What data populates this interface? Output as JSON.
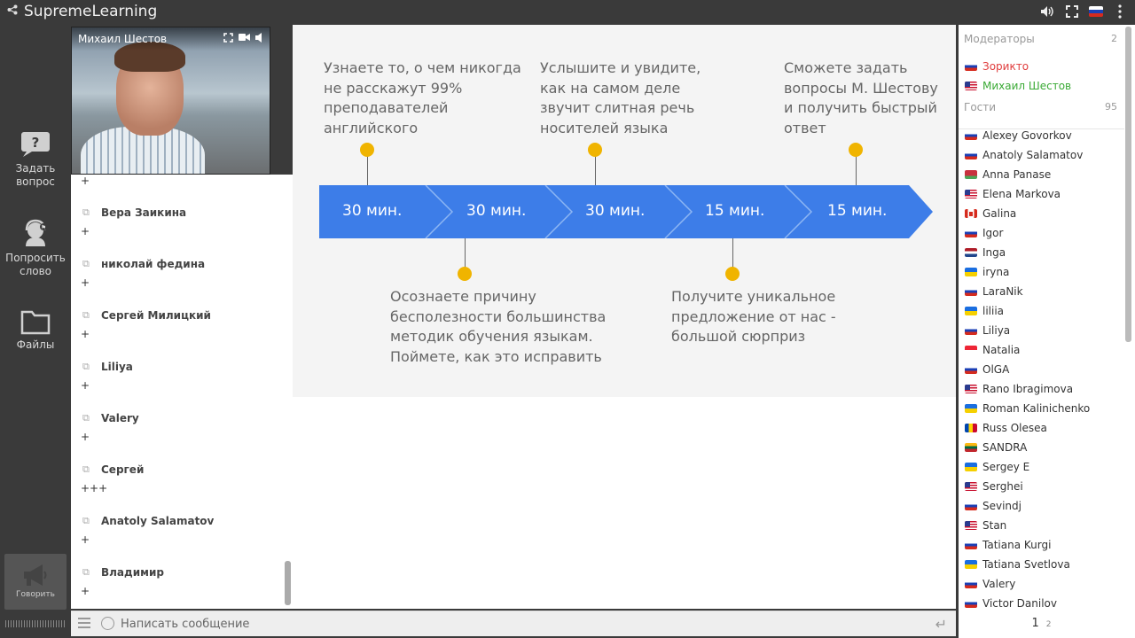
{
  "app": {
    "title": "SupremeLearning"
  },
  "topbar": {
    "icons": [
      "share-icon",
      "volume-icon",
      "fullscreen-icon",
      "language-ru-flag"
    ]
  },
  "leftbar": {
    "ask_label": "Задать вопрос",
    "ask_line1": "Задать",
    "ask_line2": "вопрос",
    "word_line1": "Попросить",
    "word_line2": "слово",
    "files_label": "Файлы",
    "speak_label": "Говорить"
  },
  "video": {
    "presenter": "Михаил Шестов"
  },
  "chat": {
    "messages": [
      {
        "name": "",
        "text": "+"
      },
      {
        "name": "Вера Заикина",
        "text": "+"
      },
      {
        "name": "николай федина",
        "text": "+"
      },
      {
        "name": "Сергей Милицкий",
        "text": "+"
      },
      {
        "name": "Liliya",
        "text": "+"
      },
      {
        "name": "Valery",
        "text": "+"
      },
      {
        "name": "Сергей",
        "text": "+++"
      },
      {
        "name": "Anatoly Salamatov",
        "text": "+"
      },
      {
        "name": "Владимир",
        "text": "+"
      }
    ],
    "composer_placeholder": "Написать сообщение"
  },
  "slide": {
    "top_texts": [
      [
        "Узнаете то, о чем никогда",
        "не расскажут 99%",
        "преподавателей",
        "английского"
      ],
      [
        "Услышите и увидите,",
        "как на самом деле",
        "звучит слитная речь",
        "носителей языка"
      ],
      [
        "Сможете задать",
        "вопросы М. Шестову",
        "и получить быстрый",
        "ответ"
      ]
    ],
    "bottom_texts": [
      [
        "Осознаете причину",
        "бесполезности большинства",
        "методик обучения языкам.",
        "Поймете, как это исправить"
      ],
      [
        "Получите уникальное",
        "предложение от нас -",
        "большой сюрприз"
      ]
    ],
    "segments": [
      "30 мин.",
      "30 мин.",
      "30 мин.",
      "15 мин.",
      "15 мин."
    ],
    "colors": {
      "arrow": "#3d7de8",
      "dot": "#f0b400"
    }
  },
  "sidebar": {
    "moderators_label": "Модераторы",
    "moderators_count": "2",
    "moderators": [
      {
        "name": "Зорикто",
        "flag": "ru"
      },
      {
        "name": "Михаил Шестов",
        "flag": "us"
      }
    ],
    "guests_label": "Гости",
    "guests_count": "95",
    "guests": [
      {
        "name": "Alexey Govorkov",
        "flag": "ru"
      },
      {
        "name": "Anatoly Salamatov",
        "flag": "ru"
      },
      {
        "name": "Anna Panase",
        "flag": "by"
      },
      {
        "name": "Elena Markova",
        "flag": "us"
      },
      {
        "name": "Galina",
        "flag": "ca"
      },
      {
        "name": "Igor",
        "flag": "ru"
      },
      {
        "name": "Inga",
        "flag": "nl"
      },
      {
        "name": "iryna",
        "flag": "ua"
      },
      {
        "name": "LaraNik",
        "flag": "ru"
      },
      {
        "name": "liliia",
        "flag": "ua"
      },
      {
        "name": "Liliya",
        "flag": "ru"
      },
      {
        "name": "Natalia",
        "flag": "sg"
      },
      {
        "name": "OlGA",
        "flag": "ru"
      },
      {
        "name": "Rano Ibragimova",
        "flag": "us"
      },
      {
        "name": "Roman Kalinichenko",
        "flag": "ua"
      },
      {
        "name": "Russ Olesea",
        "flag": "md"
      },
      {
        "name": "SANDRA",
        "flag": "lt"
      },
      {
        "name": "Sergey E",
        "flag": "ua"
      },
      {
        "name": "Serghei",
        "flag": "us"
      },
      {
        "name": "Sevindj",
        "flag": "ru"
      },
      {
        "name": "Stan",
        "flag": "us"
      },
      {
        "name": "Tatiana Kurgi",
        "flag": "ru"
      },
      {
        "name": "Tatiana Svetlova",
        "flag": "ua"
      },
      {
        "name": "Valery",
        "flag": "ru"
      },
      {
        "name": "Victor Danilov",
        "flag": "ru"
      }
    ],
    "pages": [
      "1",
      "2"
    ]
  }
}
